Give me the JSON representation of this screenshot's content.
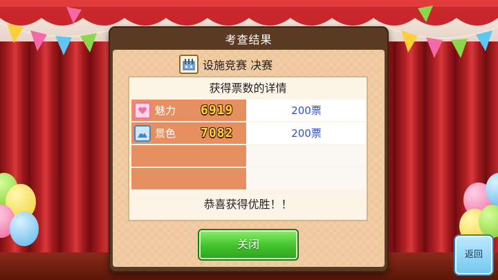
{
  "dialog": {
    "title": "考查结果",
    "subtitle": "设施竞赛 决赛",
    "subtitle_icon": "facility-building-icon"
  },
  "details": {
    "heading": "获得票数的详情",
    "rows": [
      {
        "label": "魅力",
        "score": "6919",
        "votes": "200票",
        "icon": "heart-icon",
        "icon_color": "#f26fa3"
      },
      {
        "label": "景色",
        "score": "7082",
        "votes": "200票",
        "icon": "mountain-icon",
        "icon_color": "#3f86c8"
      }
    ],
    "footer": "恭喜获得优胜！！"
  },
  "buttons": {
    "close": "关闭",
    "back": "返回"
  },
  "colors": {
    "row_label_bg": "#e88f62",
    "votes_text": "#2f4fd6",
    "close_button": "#3fc22b",
    "back_button": "#6fc6f4"
  }
}
